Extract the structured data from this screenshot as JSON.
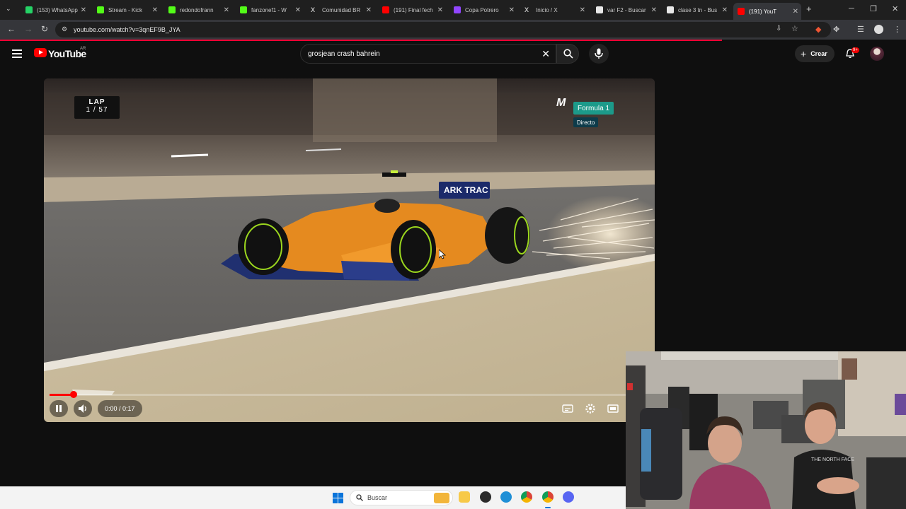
{
  "browser": {
    "tabs": [
      {
        "label": "(153) WhatsApp",
        "favicon": "whatsapp-icon",
        "color": "#25d366",
        "active": false
      },
      {
        "label": "Stream - Kick",
        "favicon": "kick-icon",
        "color": "#53fc18",
        "active": false
      },
      {
        "label": "redondofrann",
        "favicon": "kick-icon",
        "color": "#53fc18",
        "active": false
      },
      {
        "label": "fanzonef1 - W",
        "favicon": "kick-icon",
        "color": "#53fc18",
        "active": false
      },
      {
        "label": "Comunidad BR",
        "favicon": "x-icon",
        "color": "#ffffff",
        "active": false
      },
      {
        "label": "(191) Final fech",
        "favicon": "youtube-icon",
        "color": "#ff0000",
        "active": false
      },
      {
        "label": "Copa Potrero",
        "favicon": "twitch-icon",
        "color": "#9146ff",
        "active": false
      },
      {
        "label": "Inicio / X",
        "favicon": "x-icon",
        "color": "#ffffff",
        "active": false
      },
      {
        "label": "var F2 - Buscar",
        "favicon": "google-icon",
        "color": "#e8e8e8",
        "active": false
      },
      {
        "label": "clase 3 tn - Bus",
        "favicon": "google-icon",
        "color": "#e8e8e8",
        "active": false
      },
      {
        "label": "(191) YouT",
        "favicon": "youtube-icon",
        "color": "#ff0000",
        "active": true
      }
    ],
    "url": "youtube.com/watch?v=3qnEF9B_JYA"
  },
  "youtube": {
    "logo_text": "YouTube",
    "region": "AR",
    "search_query": "grosjean crash bahrein",
    "create_label": "Crear",
    "notif_count": "9+",
    "accent": "#ff0000"
  },
  "video": {
    "lap_title": "LAP",
    "lap_count": "1 / 57",
    "broadcaster_mark": "M",
    "series_badge": "Formula 1",
    "live_badge": "Directo",
    "car_sponsor": "ARK TRAC",
    "time": "0:00 / 0:17",
    "progress": 0.04
  },
  "taskbar": {
    "search_placeholder": "Buscar"
  }
}
